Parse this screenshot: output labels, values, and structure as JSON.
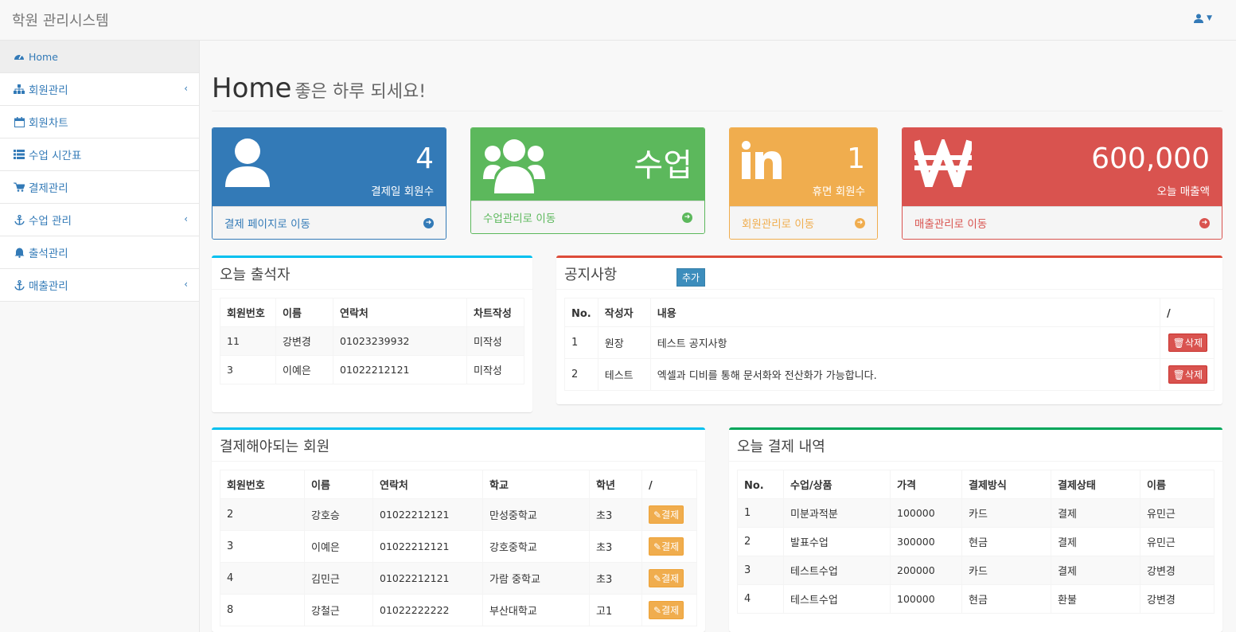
{
  "navbar": {
    "brand": "학원 관리시스템"
  },
  "sidebar": {
    "items": [
      {
        "label": "Home",
        "icon": "dashboard-icon"
      },
      {
        "label": "회원관리",
        "icon": "sitemap-icon",
        "arrow": "‹"
      },
      {
        "label": "회원차트",
        "icon": "calendar-icon"
      },
      {
        "label": "수업 시간표",
        "icon": "list-icon"
      },
      {
        "label": "결제관리",
        "icon": "cart-icon"
      },
      {
        "label": "수업 관리",
        "icon": "anchor-icon",
        "arrow": "‹"
      },
      {
        "label": "출석관리",
        "icon": "bell-icon"
      },
      {
        "label": "매출관리",
        "icon": "anchor-icon",
        "arrow": "‹"
      }
    ]
  },
  "header": {
    "title": "Home",
    "subtitle": "좋은 하루 되세요!"
  },
  "stats": [
    {
      "value": "4",
      "label": "결제일 회원수",
      "link": "결제 페이지로 이동",
      "color": "#337ab7",
      "icon": "user-icon"
    },
    {
      "value": "수업",
      "label": "",
      "link": "수업관리로 이동",
      "color": "#5cb85c",
      "icon": "users-icon"
    },
    {
      "value": "1",
      "label": "휴면 회원수",
      "link": "회원관리로 이동",
      "color": "#f0ad4e",
      "icon": "linkedin-icon"
    },
    {
      "value": "600,000",
      "label": "오늘 매출액",
      "link": "매출관리로 이동",
      "color": "#d9534f",
      "icon": "won-icon"
    }
  ],
  "attendance": {
    "title": "오늘 출석자",
    "headers": [
      "회원번호",
      "이름",
      "연락처",
      "차트작성"
    ],
    "rows": [
      [
        "11",
        "강변경",
        "01023239932",
        "미작성"
      ],
      [
        "3",
        "이예은",
        "01022212121",
        "미작성"
      ]
    ]
  },
  "notice": {
    "title": "공지사항",
    "add_label": "추가",
    "headers": [
      "No.",
      "작성자",
      "내용",
      "/"
    ],
    "delete_label": "삭제",
    "rows": [
      [
        "1",
        "원장",
        "테스트 공지사항"
      ],
      [
        "2",
        "테스트",
        "엑셀과 디비를 통해 문서화와 전산화가 가능합니다."
      ]
    ]
  },
  "due": {
    "title": "결제해야되는 회원",
    "headers": [
      "회원번호",
      "이름",
      "연락처",
      "학교",
      "학년",
      "/"
    ],
    "pay_label": "결제",
    "rows": [
      [
        "2",
        "강호승",
        "01022212121",
        "만성중학교",
        "초3"
      ],
      [
        "3",
        "이예은",
        "01022212121",
        "강호중학교",
        "초3"
      ],
      [
        "4",
        "김민근",
        "01022212121",
        "가람 중학교",
        "초3"
      ],
      [
        "8",
        "강철근",
        "01022222222",
        "부산대학교",
        "고1"
      ]
    ]
  },
  "payments": {
    "title": "오늘 결제 내역",
    "headers": [
      "No.",
      "수업/상품",
      "가격",
      "결제방식",
      "결제상태",
      "이름"
    ],
    "rows": [
      [
        "1",
        "미분과적분",
        "100000",
        "카드",
        "결제",
        "유민근"
      ],
      [
        "2",
        "발표수업",
        "300000",
        "현금",
        "결제",
        "유민근"
      ],
      [
        "3",
        "테스트수업",
        "200000",
        "카드",
        "결제",
        "강변경"
      ],
      [
        "4",
        "테스트수업",
        "100000",
        "현금",
        "환불",
        "강변경"
      ]
    ]
  }
}
